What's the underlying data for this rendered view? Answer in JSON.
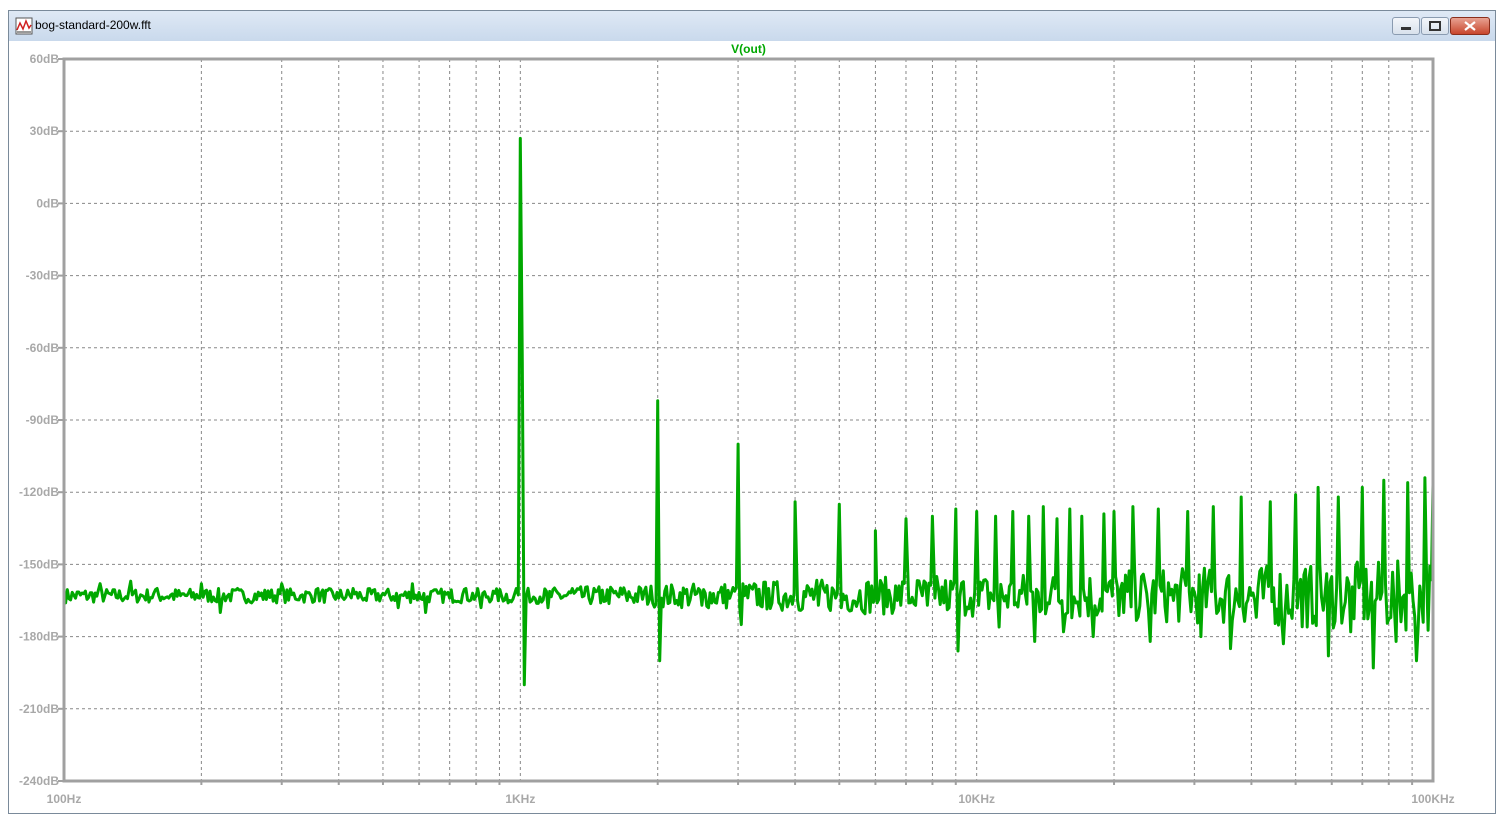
{
  "window": {
    "title": "bog-standard-200w.fft",
    "controls": {
      "minimize": "minimize",
      "maximize": "maximize",
      "close": "close"
    }
  },
  "colors": {
    "trace": "#00a800",
    "grid": "#888888",
    "axis": "#a0a0a0",
    "labels": "#a8a8a8"
  },
  "chart_data": {
    "type": "line",
    "title": "V(out)",
    "xscale": "log",
    "xlim": [
      100,
      100000
    ],
    "ylim": [
      -240,
      60
    ],
    "y_ticks": [
      60,
      30,
      0,
      -30,
      -60,
      -90,
      -120,
      -150,
      -180,
      -210,
      -240
    ],
    "y_tick_labels": [
      "60dB",
      "30dB",
      "0dB",
      "-30dB",
      "-60dB",
      "-90dB",
      "-120dB",
      "-150dB",
      "-180dB",
      "-210dB",
      "-240dB"
    ],
    "x_ticks": [
      100,
      1000,
      10000,
      100000
    ],
    "x_tick_labels": [
      "100Hz",
      "1KHz",
      "10KHz",
      "100KHz"
    ],
    "grid": true,
    "series": [
      {
        "name": "V(out)",
        "noise_floor_db": -163,
        "points": [
          [
            100,
            -162
          ],
          [
            120,
            -158
          ],
          [
            140,
            -157
          ],
          [
            160,
            -160
          ],
          [
            180,
            -163
          ],
          [
            200,
            -158
          ],
          [
            220,
            -170
          ],
          [
            240,
            -160
          ],
          [
            260,
            -165
          ],
          [
            280,
            -161
          ],
          [
            300,
            -158
          ],
          [
            330,
            -163
          ],
          [
            360,
            -160
          ],
          [
            400,
            -164
          ],
          [
            430,
            -160
          ],
          [
            460,
            -165
          ],
          [
            500,
            -162
          ],
          [
            540,
            -168
          ],
          [
            580,
            -158
          ],
          [
            620,
            -170
          ],
          [
            660,
            -162
          ],
          [
            700,
            -164
          ],
          [
            760,
            -160
          ],
          [
            820,
            -168
          ],
          [
            880,
            -162
          ],
          [
            940,
            -166
          ],
          [
            980,
            -160
          ],
          [
            1000,
            27
          ],
          [
            1010,
            -66
          ],
          [
            1020,
            -200
          ],
          [
            1060,
            -165
          ],
          [
            1150,
            -168
          ],
          [
            1300,
            -160
          ],
          [
            1500,
            -166
          ],
          [
            1700,
            -162
          ],
          [
            1950,
            -166
          ],
          [
            2000,
            -82
          ],
          [
            2020,
            -190
          ],
          [
            2200,
            -165
          ],
          [
            2500,
            -167
          ],
          [
            2900,
            -162
          ],
          [
            3000,
            -100
          ],
          [
            3050,
            -175
          ],
          [
            3500,
            -160
          ],
          [
            3980,
            -162
          ],
          [
            4000,
            -124
          ],
          [
            4050,
            -165
          ],
          [
            4500,
            -167
          ],
          [
            4950,
            -162
          ],
          [
            5000,
            -125
          ],
          [
            5050,
            -168
          ],
          [
            5500,
            -165
          ],
          [
            5990,
            -162
          ],
          [
            6000,
            -136
          ],
          [
            6050,
            -166
          ],
          [
            6700,
            -165
          ],
          [
            7000,
            -131
          ],
          [
            7100,
            -166
          ],
          [
            7800,
            -167
          ],
          [
            8000,
            -130
          ],
          [
            8100,
            -164
          ],
          [
            8700,
            -168
          ],
          [
            9000,
            -127
          ],
          [
            9100,
            -186
          ],
          [
            9700,
            -164
          ],
          [
            10000,
            -128
          ],
          [
            10100,
            -167
          ],
          [
            11000,
            -130
          ],
          [
            11200,
            -176
          ],
          [
            12000,
            -128
          ],
          [
            12200,
            -166
          ],
          [
            13000,
            -130
          ],
          [
            13400,
            -182
          ],
          [
            14000,
            -126
          ],
          [
            14300,
            -166
          ],
          [
            15000,
            -131
          ],
          [
            15500,
            -178
          ],
          [
            16000,
            -127
          ],
          [
            16500,
            -166
          ],
          [
            17000,
            -130
          ],
          [
            18000,
            -180
          ],
          [
            19000,
            -129
          ],
          [
            20000,
            -128
          ],
          [
            21000,
            -170
          ],
          [
            22000,
            -126
          ],
          [
            24000,
            -182
          ],
          [
            25000,
            -127
          ],
          [
            27000,
            -165
          ],
          [
            29000,
            -128
          ],
          [
            31000,
            -180
          ],
          [
            33000,
            -126
          ],
          [
            36000,
            -185
          ],
          [
            38000,
            -122
          ],
          [
            41000,
            -172
          ],
          [
            44000,
            -124
          ],
          [
            47000,
            -183
          ],
          [
            50000,
            -121
          ],
          [
            53000,
            -176
          ],
          [
            56000,
            -118
          ],
          [
            59000,
            -188
          ],
          [
            62000,
            -122
          ],
          [
            66000,
            -178
          ],
          [
            70000,
            -118
          ],
          [
            74000,
            -193
          ],
          [
            78000,
            -115
          ],
          [
            83000,
            -182
          ],
          [
            88000,
            -116
          ],
          [
            92000,
            -190
          ],
          [
            96000,
            -114
          ],
          [
            100000,
            -117
          ]
        ]
      }
    ]
  }
}
